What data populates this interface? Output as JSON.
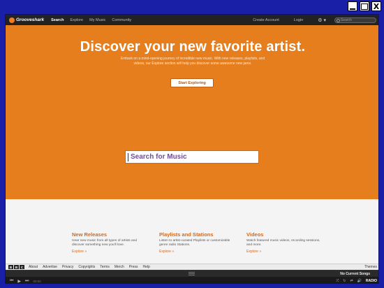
{
  "window": {
    "minimize_icon": "minimize-icon",
    "maximize_icon": "maximize-icon",
    "close_label": "X"
  },
  "nav": {
    "logo_text": "Grooveshark",
    "links": [
      "Search",
      "Explore",
      "My Music",
      "Community"
    ],
    "active_link": "Search",
    "create_account": "Create Account",
    "login": "Login",
    "settings_icon": "gear-icon",
    "search_placeholder": "Search"
  },
  "hero": {
    "title": "Discover your new favorite artist.",
    "subtitle": "Embark on a mind-opening journey of incredible new music. With new releases, playlists, and videos, our Explore section will help you discover some awesome new jams.",
    "button_label": "Start Exploring",
    "search_placeholder": "Search for Music",
    "background_color": "#e67e1e"
  },
  "features": [
    {
      "title": "New Releases",
      "text": "Hear new music from all types of artists and discover something new you'll love.",
      "link": "Explore »"
    },
    {
      "title": "Playlists and Stations",
      "text": "Listen to artist-curated Playlists or customizable genre radio Stations.",
      "link": "Explore »"
    },
    {
      "title": "Videos",
      "text": "Watch featured music videos, recording sessions, and more.",
      "link": "Explore »"
    }
  ],
  "footer": {
    "brand_letters": [
      "B",
      "B",
      "C"
    ],
    "links": [
      "About",
      "Advertise",
      "Privacy",
      "Copyrights",
      "Terms",
      "Merch",
      "Press",
      "Help"
    ],
    "themes": "Themes"
  },
  "player": {
    "status": "No Current Songs",
    "radio_label": "RADIO",
    "time": "00:00",
    "controls": [
      "prev-icon",
      "play-icon",
      "next-icon"
    ]
  },
  "colors": {
    "accent": "#e67e1e",
    "accent_text": "#d3691b",
    "nav_bg": "#222222",
    "window_border": "#1a1fa8"
  }
}
